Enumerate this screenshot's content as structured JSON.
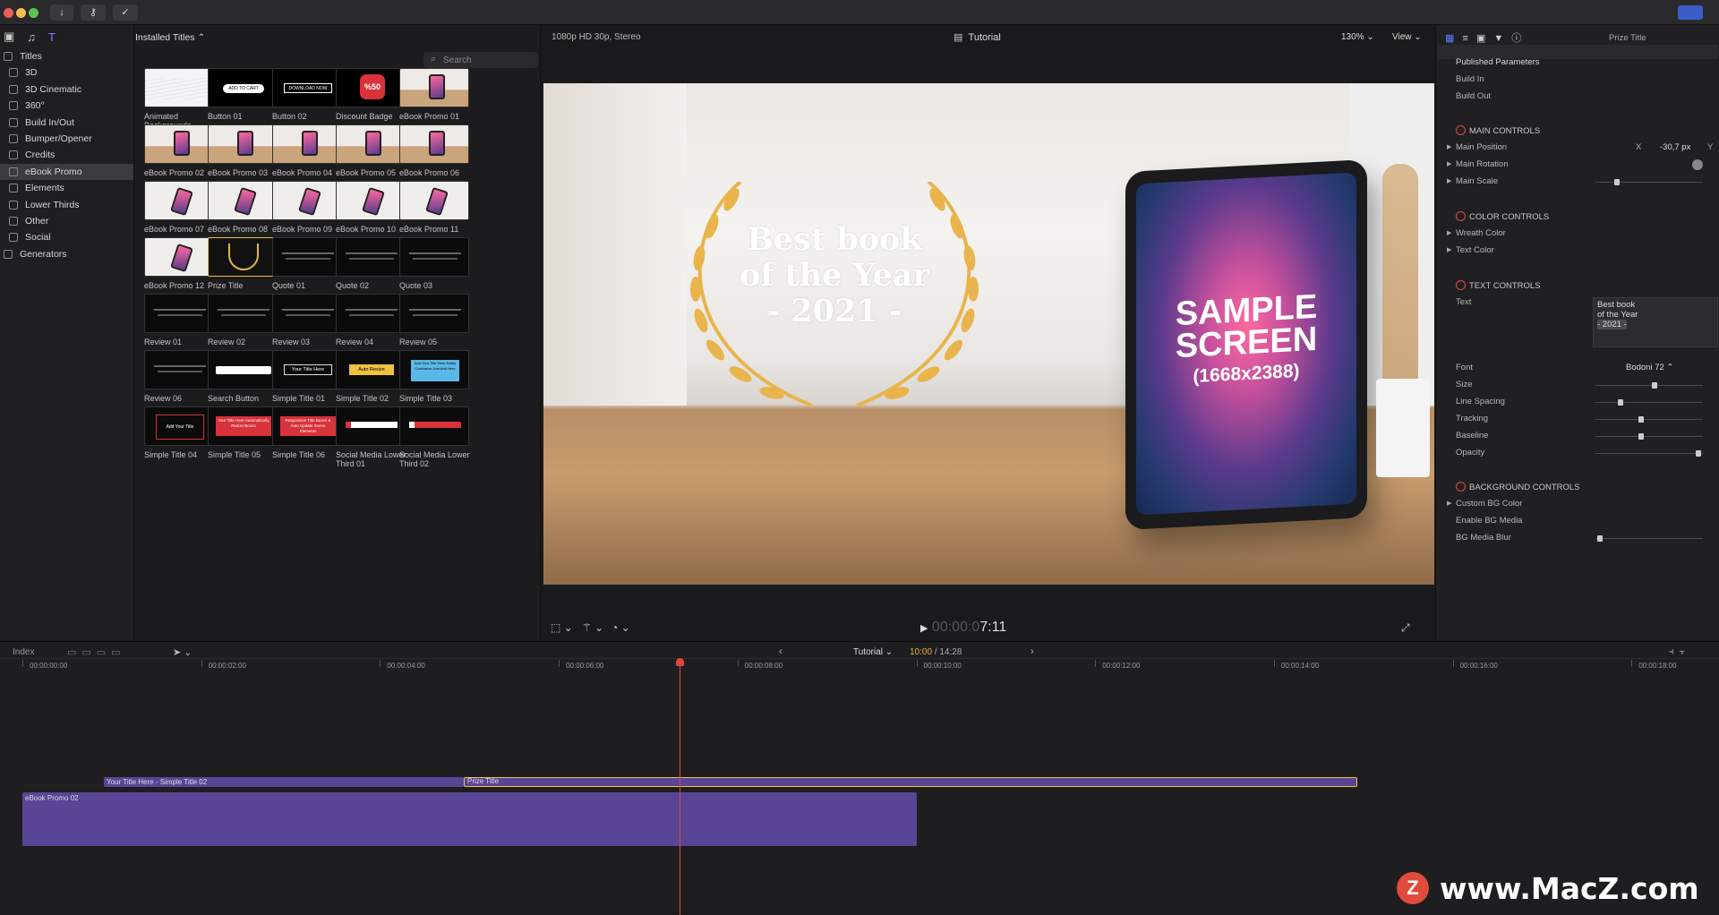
{
  "window": {
    "traffic_colors": [
      "#ec5f57",
      "#f5bd4f",
      "#5fc454"
    ],
    "toolbar_icons": [
      "download-icon",
      "key-icon",
      "check-circle-icon"
    ]
  },
  "sidebar": {
    "root_label": "Titles",
    "categories": [
      "3D",
      "3D Cinematic",
      "360°",
      "Build In/Out",
      "Bumper/Opener",
      "Credits",
      "eBook Promo",
      "Elements",
      "Lower Thirds",
      "Other",
      "Social"
    ],
    "selected": "eBook Promo",
    "generators_label": "Generators"
  },
  "browser": {
    "dropdown_label": "Installed Titles",
    "search_placeholder": "Search",
    "items": [
      {
        "label": "Animated Backgrounds",
        "style": "white"
      },
      {
        "label": "Button 01",
        "style": "btn1",
        "text": "ADD TO CART"
      },
      {
        "label": "Button 02",
        "style": "btn2",
        "text": "DOWNLOAD NOW"
      },
      {
        "label": "Discount Badge",
        "style": "badge",
        "text": "%50"
      },
      {
        "label": "eBook Promo 01",
        "style": "room"
      },
      {
        "label": "eBook Promo 02",
        "style": "room"
      },
      {
        "label": "eBook Promo 03",
        "style": "room"
      },
      {
        "label": "eBook Promo 04",
        "style": "room"
      },
      {
        "label": "eBook Promo 05",
        "style": "room"
      },
      {
        "label": "eBook Promo 06",
        "style": "room"
      },
      {
        "label": "eBook Promo 07",
        "style": "tilt"
      },
      {
        "label": "eBook Promo 08",
        "style": "tilt"
      },
      {
        "label": "eBook Promo 09",
        "style": "tilt"
      },
      {
        "label": "eBook Promo 10",
        "style": "tilt"
      },
      {
        "label": "eBook Promo 11",
        "style": "tilt"
      },
      {
        "label": "eBook Promo 12",
        "style": "tilt"
      },
      {
        "label": "Prize Title",
        "style": "prize",
        "selected": true
      },
      {
        "label": "Quote 01",
        "style": "dark"
      },
      {
        "label": "Quote 02",
        "style": "dark"
      },
      {
        "label": "Quote 03",
        "style": "dark"
      },
      {
        "label": "Review 01",
        "style": "dark"
      },
      {
        "label": "Review 02",
        "style": "dark"
      },
      {
        "label": "Review 03",
        "style": "dark"
      },
      {
        "label": "Review 04",
        "style": "dark"
      },
      {
        "label": "Review 05",
        "style": "dark"
      },
      {
        "label": "Review 06",
        "style": "dark"
      },
      {
        "label": "Search Button",
        "style": "search"
      },
      {
        "label": "Simple Title 01",
        "style": "simple1",
        "text": "Your Title Here"
      },
      {
        "label": "Simple Title 02",
        "style": "simple2",
        "text": "Auto Resize"
      },
      {
        "label": "Simple Title 03",
        "style": "simple3",
        "text": "Add Your Title Here Easily Customize Just Add Here"
      },
      {
        "label": "Simple Title 04",
        "style": "simple4",
        "text": "Add Your Title"
      },
      {
        "label": "Simple Title 05",
        "style": "red",
        "text": "Your Title Here Automatically Resize Boxes"
      },
      {
        "label": "Simple Title 06",
        "style": "red",
        "text": "Responsive Title Boxes & Auto Update Scene Elements"
      },
      {
        "label": "Social Media Lower Third 01",
        "style": "social1"
      },
      {
        "label": "Social Media Lower Third 02",
        "style": "social2"
      }
    ]
  },
  "viewer": {
    "format": "1080p HD 30p, Stereo",
    "project_name": "Tutorial",
    "zoom": "130%",
    "view_label": "View",
    "overlay_lines": [
      "Best book",
      "of the Year",
      "- 2021 -"
    ],
    "screen_line1": "SAMPLE",
    "screen_line2": "SCREEN",
    "screen_dims": "(1668x2388)",
    "timecode_dim": "00:00:0",
    "timecode_bright": "7:11"
  },
  "inspector": {
    "header_title": "Prize Title",
    "published_parameters": "Published Parameters",
    "build_in": "Build In",
    "build_out": "Build Out",
    "main_controls": "MAIN CONTROLS",
    "main_position": "Main Position",
    "pos_x_label": "X",
    "pos_x_value": "-30,7 px",
    "pos_y_label": "Y",
    "main_rotation": "Main Rotation",
    "main_scale": "Main Scale",
    "color_controls": "COLOR CONTROLS",
    "wreath_color": "Wreath Color",
    "text_color": "Text Color",
    "text_controls": "TEXT CONTROLS",
    "text_label": "Text",
    "text_lines": [
      "Best book",
      "of the Year",
      "- 2021 -"
    ],
    "font_label": "Font",
    "font_value": "Bodoni 72",
    "size": "Size",
    "line_spacing": "Line Spacing",
    "tracking": "Tracking",
    "baseline": "Baseline",
    "opacity": "Opacity",
    "background_controls": "BACKGROUND CONTROLS",
    "custom_bg_color": "Custom BG Color",
    "enable_bg_media": "Enable BG Media",
    "bg_media_blur": "BG Media Blur",
    "slider_levels": {
      "main_scale": 0.18,
      "size": 0.55,
      "line_spacing": 0.22,
      "tracking": 0.42,
      "baseline": 0.42,
      "opacity": 0.98,
      "bg_media_blur": 0.02
    }
  },
  "timeline": {
    "index_label": "Index",
    "project": "Tutorial",
    "duration_current": "10:00",
    "duration_total": " / 14:28",
    "ruler": [
      "00:00:00:00",
      "00:00:02:00",
      "00:00:04:00",
      "00:00:06:00",
      "00:00:08:00",
      "00:00:10:00",
      "00:00:12:00",
      "00:00:14:00",
      "00:00:16:00",
      "00:00:18:00"
    ],
    "clip1": "Your Title Here - Simple Title 02",
    "clip2": "Prize Title",
    "clip3": "eBook Promo 02",
    "clip_color": "#5a4496",
    "playhead_color": "#e0483e"
  },
  "watermark": {
    "text": "www.MacZ.com",
    "badge": "Z"
  }
}
